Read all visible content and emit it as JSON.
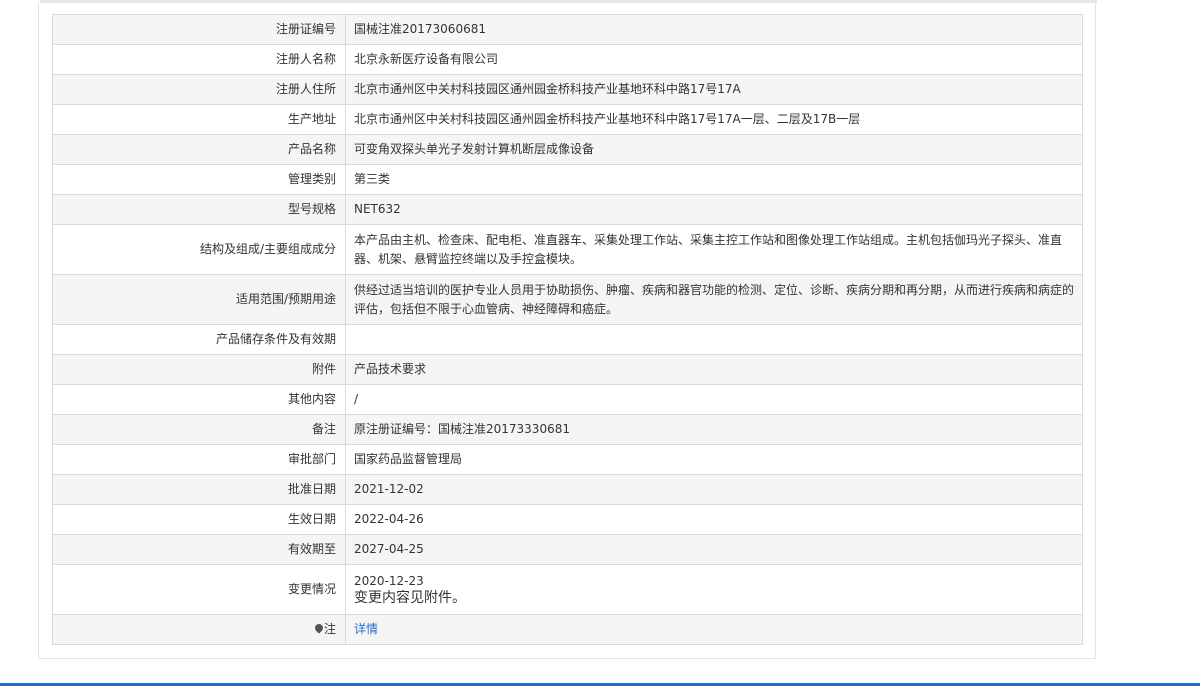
{
  "rows": [
    {
      "label": "注册证编号",
      "value": "国械注准20173060681"
    },
    {
      "label": "注册人名称",
      "value": "北京永新医疗设备有限公司"
    },
    {
      "label": "注册人住所",
      "value": "北京市通州区中关村科技园区通州园金桥科技产业基地环科中路17号17A"
    },
    {
      "label": "生产地址",
      "value": "北京市通州区中关村科技园区通州园金桥科技产业基地环科中路17号17A一层、二层及17B一层"
    },
    {
      "label": "产品名称",
      "value": "可变角双探头单光子发射计算机断层成像设备"
    },
    {
      "label": "管理类别",
      "value": "第三类"
    },
    {
      "label": "型号规格",
      "value": "NET632"
    },
    {
      "label": "结构及组成/主要组成成分",
      "value": "本产品由主机、检查床、配电柜、准直器车、采集处理工作站、采集主控工作站和图像处理工作站组成。主机包括伽玛光子探头、准直器、机架、悬臂监控终端以及手控盒模块。"
    },
    {
      "label": "适用范围/预期用途",
      "value": "供经过适当培训的医护专业人员用于协助损伤、肿瘤、疾病和器官功能的检测、定位、诊断、疾病分期和再分期，从而进行疾病和病症的评估，包括但不限于心血管病、神经障碍和癌症。"
    },
    {
      "label": "产品储存条件及有效期",
      "value": ""
    },
    {
      "label": "附件",
      "value": "产品技术要求"
    },
    {
      "label": "其他内容",
      "value": "/"
    },
    {
      "label": "备注",
      "value": "原注册证编号：国械注准20173330681"
    },
    {
      "label": "审批部门",
      "value": "国家药品监督管理局"
    },
    {
      "label": "批准日期",
      "value": "2021-12-02"
    },
    {
      "label": "生效日期",
      "value": "2022-04-26"
    },
    {
      "label": "有效期至",
      "value": "2027-04-25"
    }
  ],
  "change": {
    "label": "变更情况",
    "date": "2020-12-23",
    "note": "变更内容见附件。"
  },
  "note_row": {
    "label": "注",
    "icon": "pin-icon",
    "link_label": "详情"
  },
  "colors": {
    "link": "#1f6fd1",
    "footer_bar": "#2a6cb5",
    "row_stripe": "#f5f5f5",
    "border": "#d9d9d9"
  }
}
